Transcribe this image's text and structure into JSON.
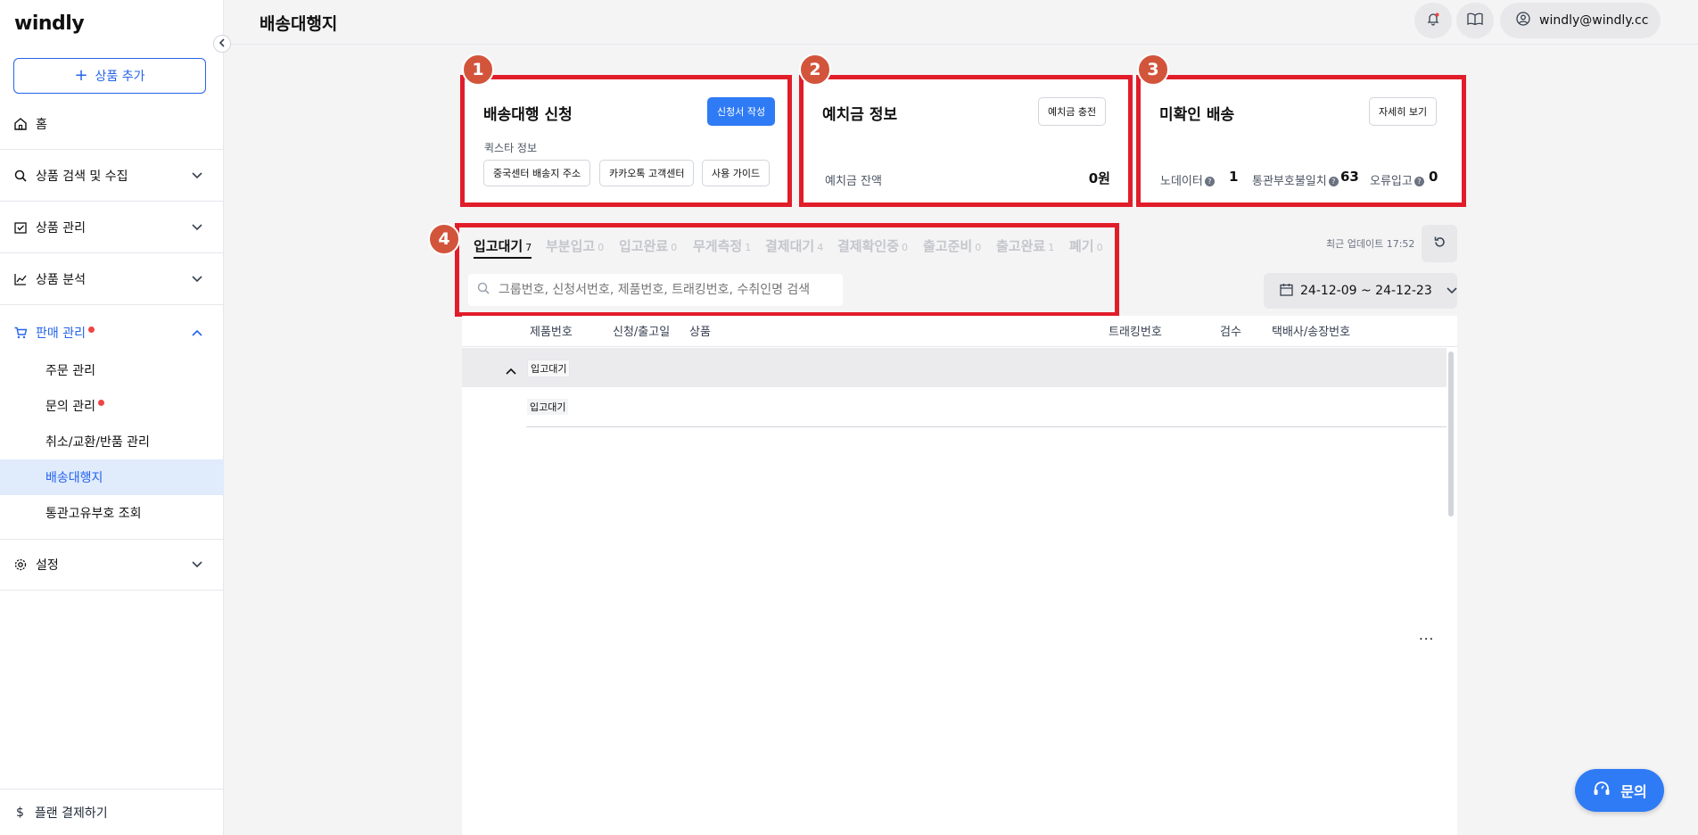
{
  "sidebar": {
    "logo": "windly",
    "add_product": "상품 추가",
    "items": [
      {
        "label": "홈"
      },
      {
        "label": "상품 검색 및 수집"
      },
      {
        "label": "상품 관리"
      },
      {
        "label": "상품 분석"
      },
      {
        "label": "판매 관리"
      },
      {
        "label": "설정"
      }
    ],
    "sub_items": [
      {
        "label": "주문 관리"
      },
      {
        "label": "문의 관리"
      },
      {
        "label": "취소/교환/반품 관리"
      },
      {
        "label": "배송대행지"
      },
      {
        "label": "통관고유부호 조회"
      }
    ],
    "plan": "플랜 결제하기"
  },
  "header": {
    "title": "배송대행지",
    "user_email": "windly@windly.cc"
  },
  "badges": [
    "1",
    "2",
    "3",
    "4"
  ],
  "card1": {
    "title": "배송대행 신청",
    "primary_button": "신청서 작성",
    "section_label": "퀵스타 정보",
    "buttons": [
      "중국센터 배송지 주소",
      "카카오톡 고객센터",
      "사용 가이드"
    ]
  },
  "card2": {
    "title": "예치금 정보",
    "button": "예치금 충전",
    "balance_label": "예치금 잔액",
    "balance_value": "0원"
  },
  "card3": {
    "title": "미확인 배송",
    "button": "자세히 보기",
    "stats": [
      {
        "label": "노데이터",
        "value": "1"
      },
      {
        "label": "통관부호불일치",
        "value": "63"
      },
      {
        "label": "오류입고",
        "value": "0"
      }
    ]
  },
  "tabs": [
    {
      "label": "입고대기",
      "count": "7"
    },
    {
      "label": "부분입고",
      "count": "0"
    },
    {
      "label": "입고완료",
      "count": "0"
    },
    {
      "label": "무게측정",
      "count": "1"
    },
    {
      "label": "결제대기",
      "count": "4"
    },
    {
      "label": "결제확인중",
      "count": "0"
    },
    {
      "label": "출고준비",
      "count": "0"
    },
    {
      "label": "출고완료",
      "count": "1"
    },
    {
      "label": "폐기",
      "count": "0"
    }
  ],
  "search": {
    "placeholder": "그룹번호, 신청서번호, 제품번호, 트래킹번호, 수취인명 검색"
  },
  "last_update": "최근 업데이트 17:52",
  "date_range": "24-12-09 ~ 24-12-23",
  "table": {
    "headers": [
      "제품번호",
      "신청/출고일",
      "상품",
      "트래킹번호",
      "검수",
      "택배사/송장번호"
    ],
    "group_tag": "입고대기",
    "row_tag": "입고대기",
    "more": "..."
  },
  "help_button": "문의",
  "colors": {
    "accent": "#2f7bf5",
    "highlight_border": "#e11d2a",
    "badge": "#d2553b"
  }
}
